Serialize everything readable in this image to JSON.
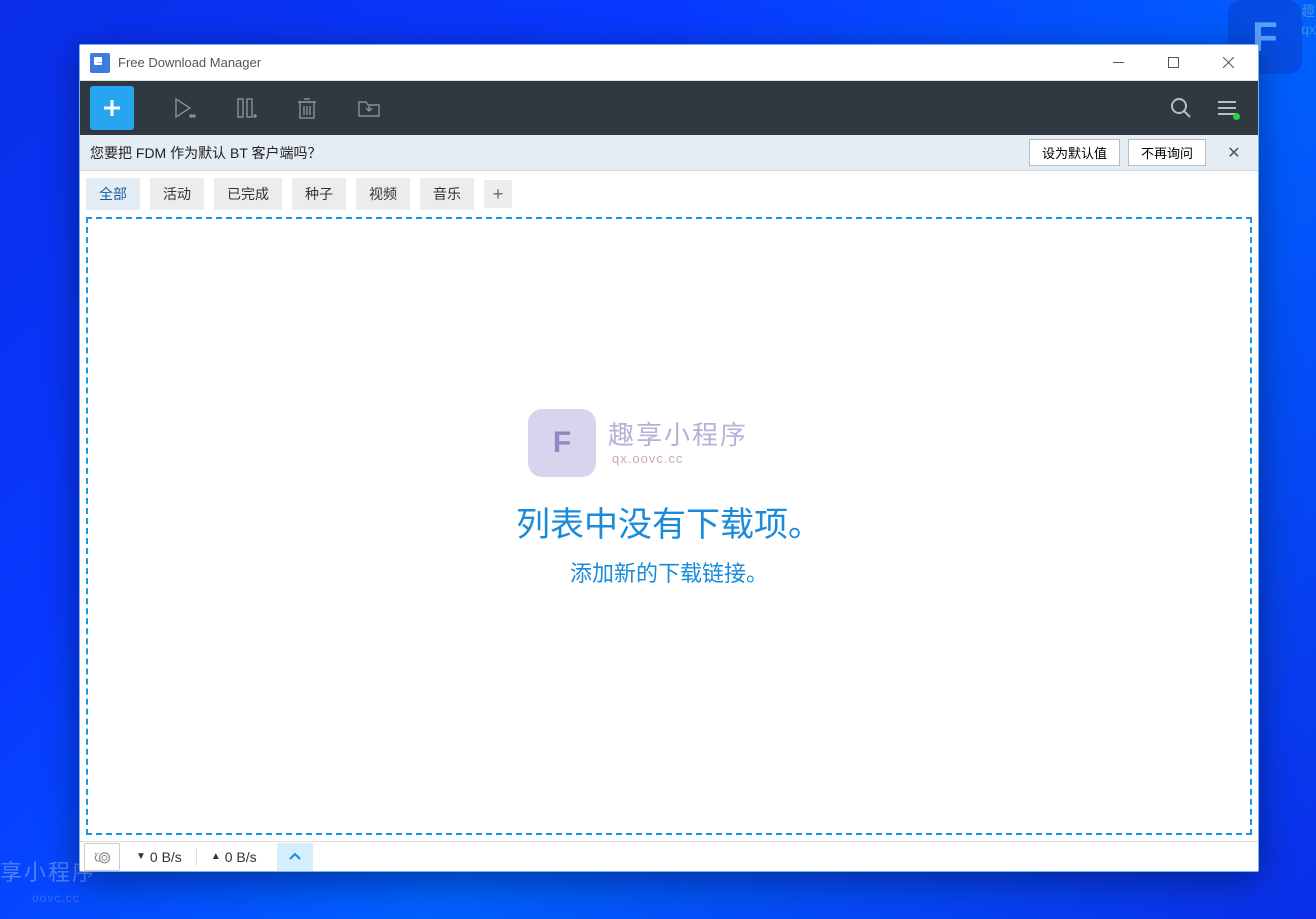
{
  "desktop": {
    "ghost_label": "趣",
    "ghost_side": "qx",
    "ghost_bottom": "享小程序",
    "ghost_bottom_sub": "oovc.cc"
  },
  "titlebar": {
    "app_name": "Free Download Manager"
  },
  "notification": {
    "message": "您要把 FDM 作为默认 BT 客户端吗？",
    "set_default": "设为默认值",
    "dont_ask": "不再询问"
  },
  "tabs": {
    "items": [
      {
        "label": "全部",
        "active": true
      },
      {
        "label": "活动",
        "active": false
      },
      {
        "label": "已完成",
        "active": false
      },
      {
        "label": "种子",
        "active": false
      },
      {
        "label": "视频",
        "active": false
      },
      {
        "label": "音乐",
        "active": false
      }
    ]
  },
  "watermark": {
    "icon": "F",
    "title": "趣享小程序",
    "sub": "qx.oovc.cc"
  },
  "empty": {
    "title": "列表中没有下载项。",
    "subtitle": "添加新的下载链接。"
  },
  "statusbar": {
    "down_speed": "0 B/s",
    "up_speed": "0 B/s"
  }
}
